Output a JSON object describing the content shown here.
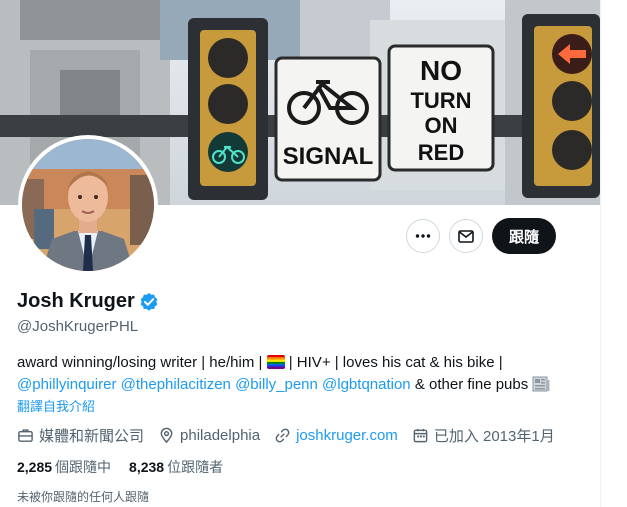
{
  "banner": {
    "sign_bike_label": "SIGNAL",
    "sign_red_line1": "NO",
    "sign_red_line2": "TURN",
    "sign_red_line3": "ON",
    "sign_red_line4": "RED"
  },
  "actions": {
    "more_icon": "more-horizontal",
    "message_icon": "envelope",
    "follow_label": "跟隨"
  },
  "profile": {
    "name": "Josh Kruger",
    "handle": "@JoshKrugerPHL",
    "verified_color": "#1d9bf0"
  },
  "bio": {
    "line1_a": "award winning/losing writer | he/him | ",
    "line1_b": " | HIV+ | loves his cat & his bike |",
    "mentions": [
      "@phillyinquirer",
      "@thephilacitizen",
      "@billy_penn",
      "@lgbtqnation"
    ],
    "tail": " & other fine pubs ",
    "translate_label": "翻譯自我介紹"
  },
  "meta": {
    "category": "媒體和新聞公司",
    "location": "philadelphia",
    "website": "joshkruger.com",
    "joined": "已加入 2013年1月"
  },
  "stats": {
    "following_count": "2,285",
    "following_label": "個跟隨中",
    "followers_count": "8,238",
    "followers_label": "位跟隨者"
  },
  "notice": "未被你跟隨的任何人跟隨",
  "colors": {
    "accent": "#1d9bf0",
    "text": "#0f1419",
    "muted": "#536471"
  }
}
